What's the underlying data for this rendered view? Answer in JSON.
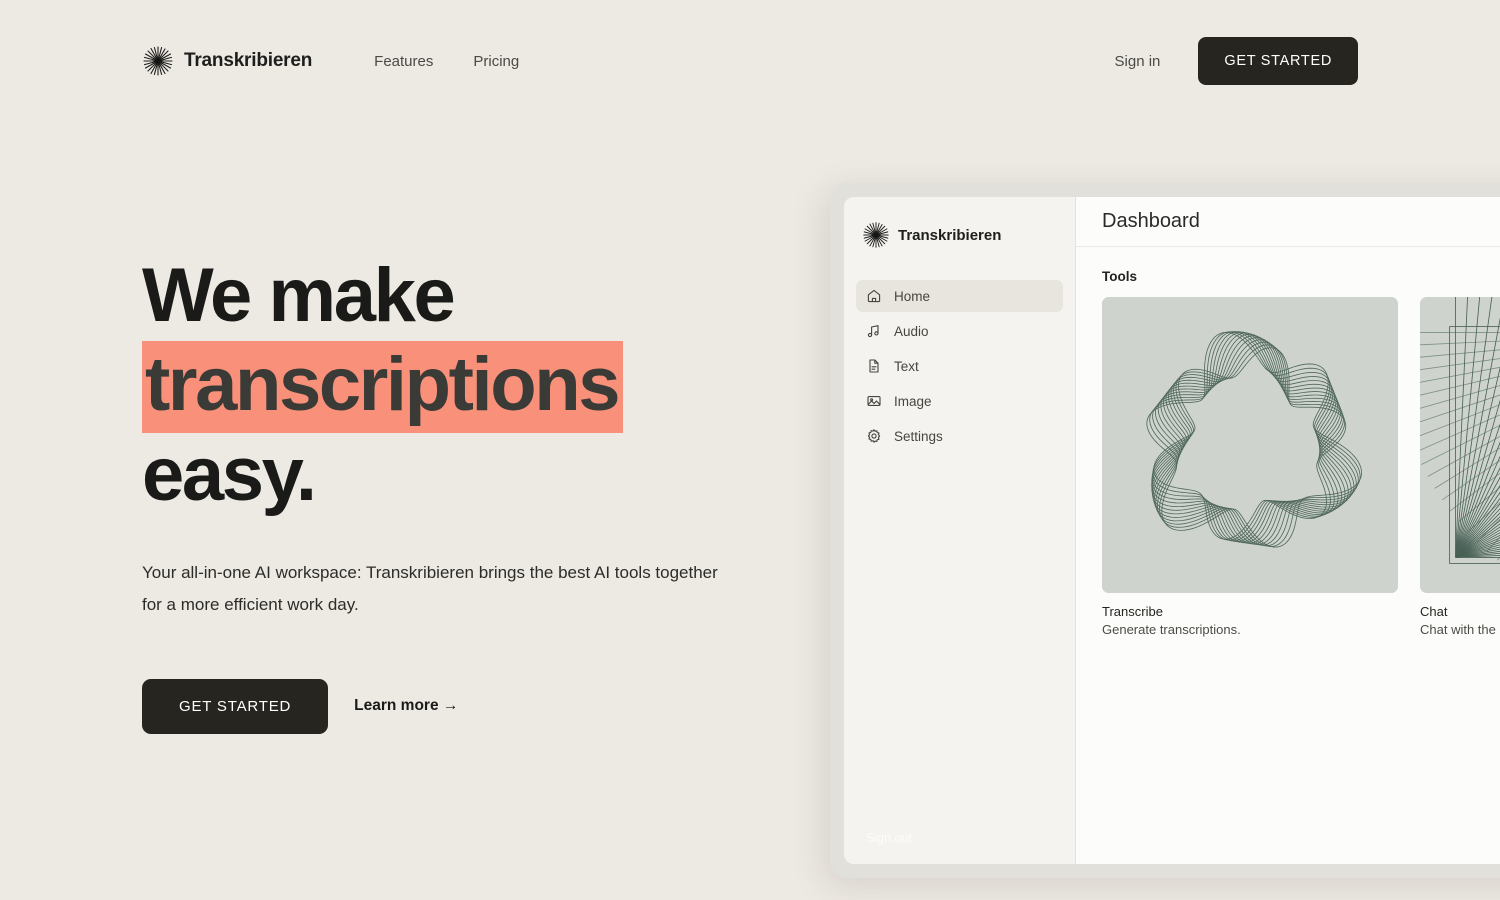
{
  "brand": {
    "name": "Transkribieren",
    "icon": "starburst-icon"
  },
  "nav": {
    "links": [
      {
        "label": "Features"
      },
      {
        "label": "Pricing"
      }
    ],
    "signin_label": "Sign in",
    "cta_label": "GET STARTED"
  },
  "hero": {
    "headline_line1": "We make",
    "headline_highlight": "transcriptions",
    "headline_line3": "easy.",
    "highlight_color": "#F9917A",
    "subtitle": "Your all-in-one AI workspace: Transkribieren brings the best AI tools together for a more efficient work day.",
    "cta_primary": "GET STARTED",
    "cta_secondary": "Learn more →"
  },
  "app": {
    "brand_name": "Transkribieren",
    "sidebar": {
      "items": [
        {
          "label": "Home",
          "icon": "home-icon",
          "active": true
        },
        {
          "label": "Audio",
          "icon": "music-note-icon",
          "active": false
        },
        {
          "label": "Text",
          "icon": "document-icon",
          "active": false
        },
        {
          "label": "Image",
          "icon": "image-icon",
          "active": false
        },
        {
          "label": "Settings",
          "icon": "gear-icon",
          "active": false
        }
      ],
      "signout_label": "Sign out"
    },
    "header_title": "Dashboard",
    "section_label": "Tools",
    "cards": [
      {
        "title": "Transcribe",
        "description": "Generate transcriptions.",
        "art": "wavy-concentric-loops",
        "art_bg": "#CED4CD",
        "art_stroke": "#3C564B"
      },
      {
        "title": "Chat",
        "description": "Chat with the l",
        "art": "radiating-fan-lines",
        "art_bg": "#CED4CD",
        "art_stroke": "#3C564B"
      }
    ]
  },
  "theme": {
    "page_bg": "#EDE9E3",
    "dark": "#26251F",
    "accent": "#F9917A",
    "sage": "#CED4CD"
  }
}
